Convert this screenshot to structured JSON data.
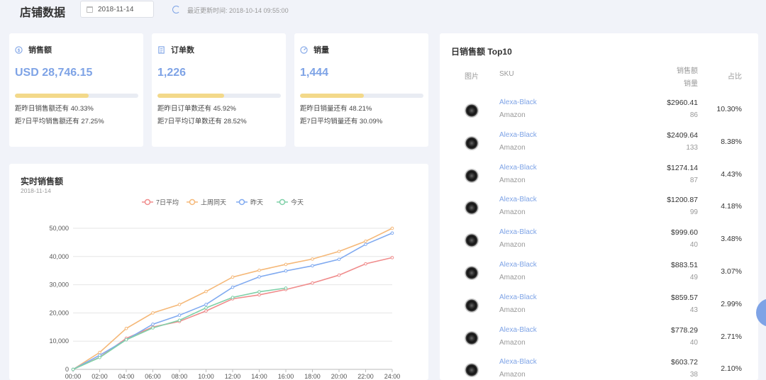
{
  "header": {
    "title": "店铺数据",
    "date": "2018-11-14",
    "update_text": "最近更新时间: 2018-10-14 09:55:00"
  },
  "kpis": [
    {
      "title": "销售额",
      "icon": "dollar-icon",
      "value": "USD 28,746.15",
      "progress": 0.6,
      "line1": "距昨日销售额还有 40.33%",
      "line2": "距7日平均销售额还有 27.25%"
    },
    {
      "title": "订单数",
      "icon": "document-icon",
      "value": "1,226",
      "progress": 0.54,
      "line1": "距昨日订单数还有 45.92%",
      "line2": "距7日平均订单数还有 28.52%"
    },
    {
      "title": "销量",
      "icon": "speedometer-icon",
      "value": "1,444",
      "progress": 0.52,
      "line1": "距昨日销量还有 48.21%",
      "line2": "距7日平均销量还有 30.09%"
    }
  ],
  "chart_card": {
    "title": "实时销售额",
    "subtitle": "2018-11-14"
  },
  "chart_data": {
    "type": "line",
    "x": [
      "00:00",
      "02:00",
      "04:00",
      "06:00",
      "08:00",
      "10:00",
      "12:00",
      "14:00",
      "16:00",
      "18:00",
      "20:00",
      "22:00",
      "24:00"
    ],
    "ylim": [
      0,
      50000
    ],
    "yticks": [
      "0",
      "10,000",
      "20,000",
      "30,000",
      "40,000",
      "50,000"
    ],
    "grid": true,
    "legend_position": "top-center",
    "series": [
      {
        "name": "7日平均",
        "color": "#f08c8c",
        "values": [
          0,
          4300,
          11000,
          15000,
          17000,
          20700,
          25000,
          26400,
          28300,
          30600,
          33400,
          37400,
          39600
        ]
      },
      {
        "name": "上周同天",
        "color": "#f5b878",
        "values": [
          0,
          6000,
          14500,
          20000,
          23000,
          27600,
          32700,
          35100,
          37200,
          39100,
          41800,
          45400,
          50000
        ]
      },
      {
        "name": "昨天",
        "color": "#80aaf0",
        "values": [
          0,
          5000,
          10500,
          16000,
          19200,
          23000,
          29100,
          32800,
          34900,
          36700,
          39000,
          44300,
          48300
        ]
      },
      {
        "name": "今天",
        "color": "#7fd0a8",
        "values": [
          0,
          4200,
          10500,
          14700,
          17400,
          21800,
          25500,
          27500,
          28800
        ]
      }
    ]
  },
  "top10": {
    "title": "日销售额 Top10",
    "headers": {
      "img": "图片",
      "sku": "SKU",
      "amount": "销售额",
      "qty": "销量",
      "pct": "占比"
    },
    "rows": [
      {
        "sku": "Alexa-Black",
        "platform": "Amazon",
        "amount": "$2960.41",
        "qty": "86",
        "pct": "10.30%"
      },
      {
        "sku": "Alexa-Black",
        "platform": "Amazon",
        "amount": "$2409.64",
        "qty": "133",
        "pct": "8.38%"
      },
      {
        "sku": "Alexa-Black",
        "platform": "Amazon",
        "amount": "$1274.14",
        "qty": "87",
        "pct": "4.43%"
      },
      {
        "sku": "Alexa-Black",
        "platform": "Amazon",
        "amount": "$1200.87",
        "qty": "99",
        "pct": "4.18%"
      },
      {
        "sku": "Alexa-Black",
        "platform": "Amazon",
        "amount": "$999.60",
        "qty": "40",
        "pct": "3.48%"
      },
      {
        "sku": "Alexa-Black",
        "platform": "Amazon",
        "amount": "$883.51",
        "qty": "49",
        "pct": "3.07%"
      },
      {
        "sku": "Alexa-Black",
        "platform": "Amazon",
        "amount": "$859.57",
        "qty": "43",
        "pct": "2.99%"
      },
      {
        "sku": "Alexa-Black",
        "platform": "Amazon",
        "amount": "$778.29",
        "qty": "40",
        "pct": "2.71%"
      },
      {
        "sku": "Alexa-Black",
        "platform": "Amazon",
        "amount": "$603.72",
        "qty": "38",
        "pct": "2.10%"
      }
    ]
  }
}
